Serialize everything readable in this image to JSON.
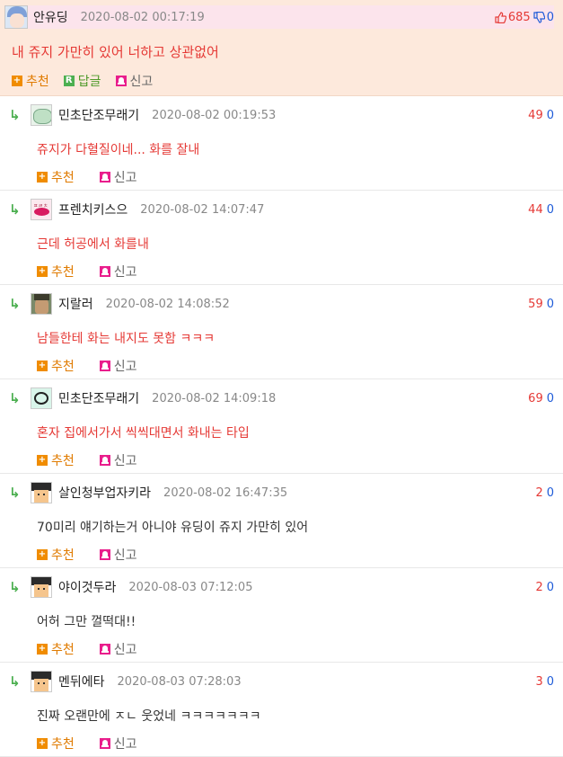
{
  "post": {
    "author": "안유딩",
    "date": "2020-08-02 00:17:19",
    "up": "685",
    "down": "0",
    "text": "내 쥬지 가만히 있어 너하고 상관없어",
    "actions": {
      "recommend": "추천",
      "reply": "답글",
      "report": "신고"
    },
    "colors": {
      "background": "#fde9dc",
      "header": "#fce4ec",
      "text": "#e53935"
    }
  },
  "replies": [
    {
      "author": "민초단조무래기",
      "date": "2020-08-02 00:19:53",
      "up": "49",
      "down": "0",
      "text": "쥬지가 다혈질이네... 화를 잘내",
      "recommend": "추천",
      "report": "신고"
    },
    {
      "author": "프렌치키스으",
      "date": "2020-08-02 14:07:47",
      "up": "44",
      "down": "0",
      "text": "근데 허공에서 화를내",
      "recommend": "추천",
      "report": "신고"
    },
    {
      "author": "지랄러",
      "date": "2020-08-02 14:08:52",
      "up": "59",
      "down": "0",
      "text": "남들한테 화는 내지도 못함 ㅋㅋㅋ",
      "recommend": "추천",
      "report": "신고"
    },
    {
      "author": "민초단조무래기",
      "date": "2020-08-02 14:09:18",
      "up": "69",
      "down": "0",
      "text": "혼자 집에서가서 씩씩대면서 화내는 타입",
      "recommend": "추천",
      "report": "신고"
    },
    {
      "author": "살인청부업자키라",
      "date": "2020-08-02 16:47:35",
      "up": "2",
      "down": "0",
      "text": "70미리 얘기하는거 아니야 유딩이 쥬지 가만히 있어",
      "recommend": "추천",
      "report": "신고"
    },
    {
      "author": "야이것두라",
      "date": "2020-08-03 07:12:05",
      "up": "2",
      "down": "0",
      "text": "어허 그만 껄떡대!!",
      "recommend": "추천",
      "report": "신고"
    },
    {
      "author": "멘뒤에타",
      "date": "2020-08-03 07:28:03",
      "up": "3",
      "down": "0",
      "text": "진짜 오랜만에 ㅈㄴ 웃었네 ㅋㅋㅋㅋㅋㅋㅋ",
      "recommend": "추천",
      "report": "신고"
    }
  ],
  "icons": {
    "reply_arrow": "reply-arrow-icon",
    "thumbs_up": "thumbs-up-icon",
    "thumbs_down": "thumbs-down-icon",
    "recommend": "plus-icon",
    "reply": "reply-r-icon",
    "report": "report-icon"
  },
  "accent_colors": {
    "up": "#e53935",
    "down": "#1e5bd8",
    "arrow": "#4caf50",
    "plus": "#f08c00"
  }
}
